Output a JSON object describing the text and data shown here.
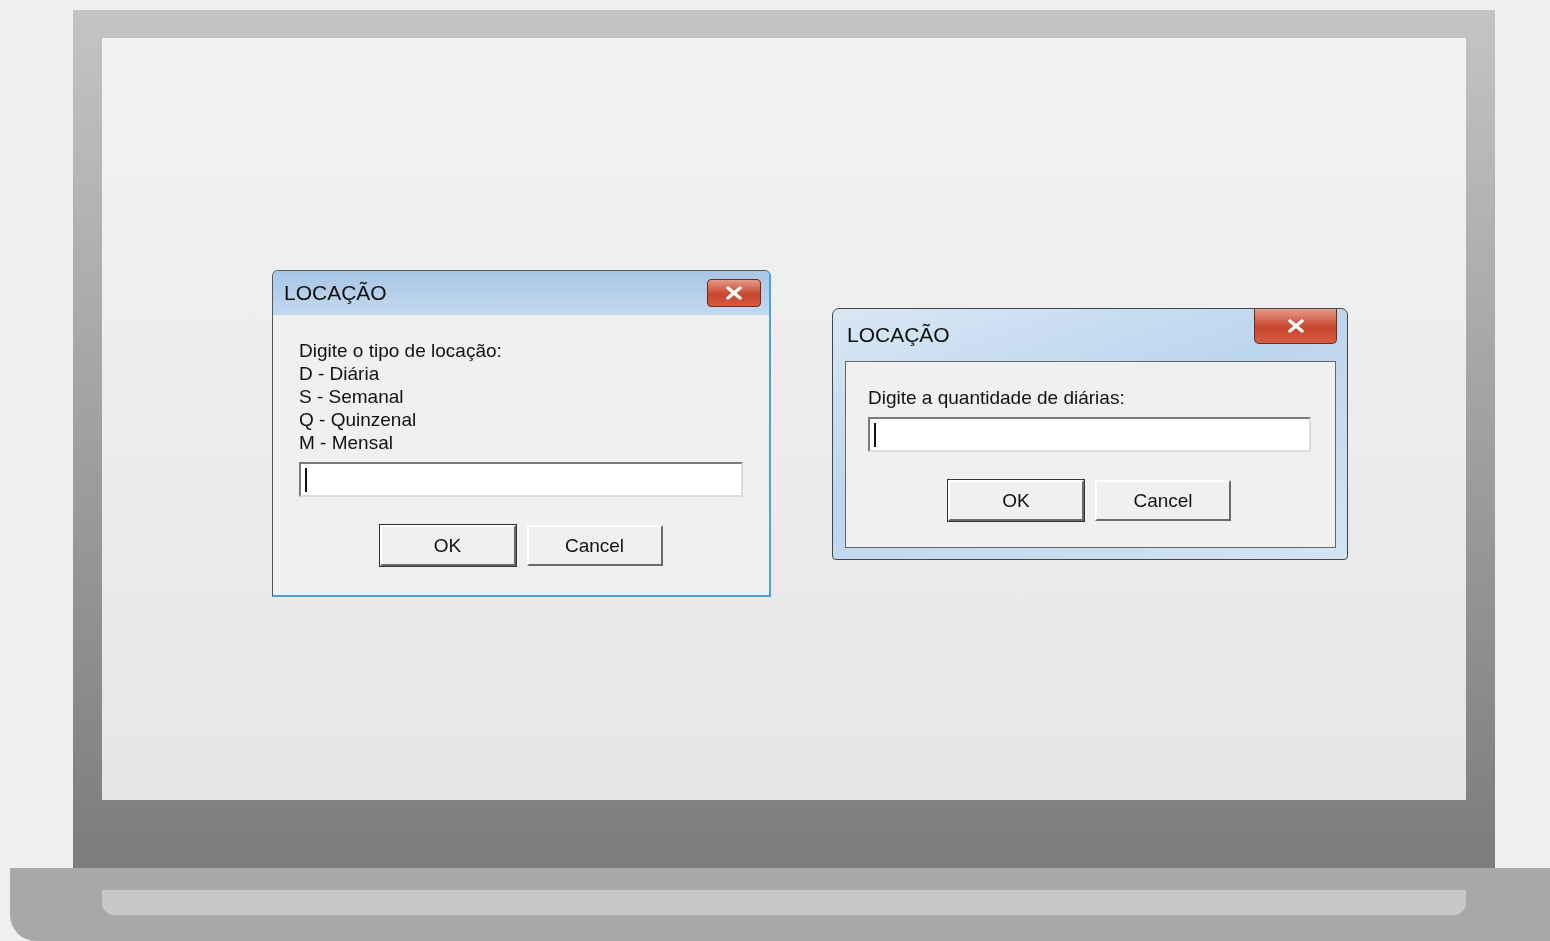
{
  "dialogs": [
    {
      "kind": "classic",
      "title": "LOCAÇÃO",
      "prompt_lines": [
        "Digite o tipo de locação:",
        "D - Diária",
        "S - Semanal",
        "Q - Quinzenal",
        "M - Mensal"
      ],
      "input": {
        "focused": true
      },
      "buttons": [
        "OK",
        "Cancel"
      ]
    },
    {
      "kind": "aero",
      "title": "LOCAÇÃO",
      "prompt_lines": [
        "Digite a quantidade de diárias:"
      ],
      "input": {
        "focused": true
      },
      "buttons": [
        "OK",
        "Cancel"
      ]
    }
  ]
}
